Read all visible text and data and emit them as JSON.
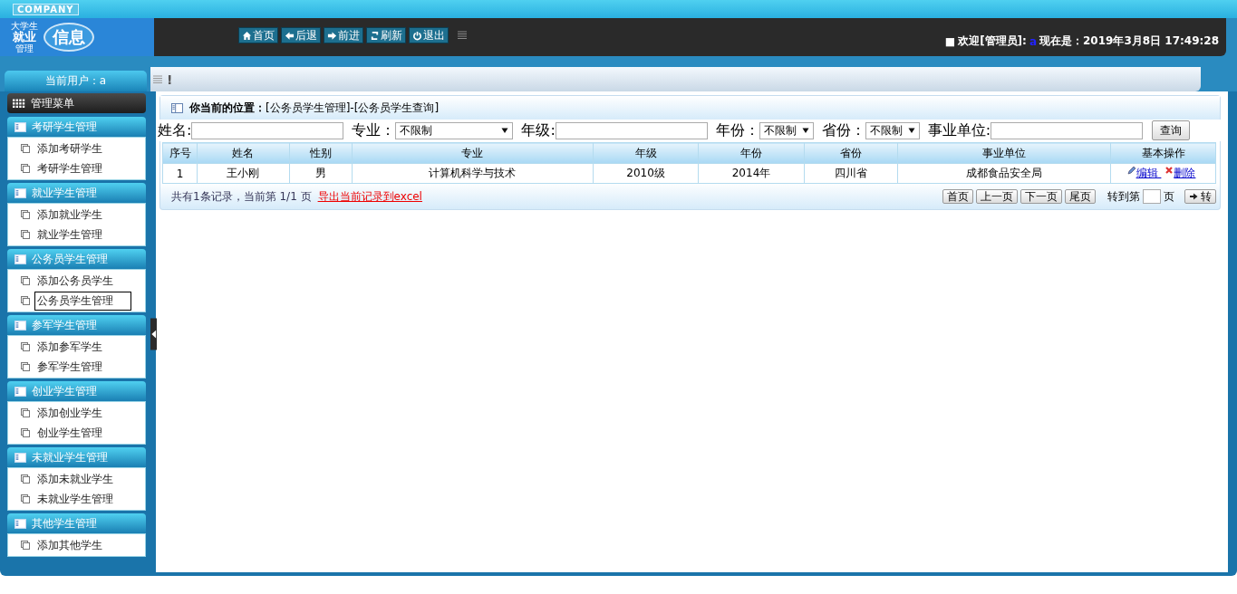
{
  "header": {
    "company": "COMPANY",
    "logo": {
      "small_top": "大学生",
      "main": "就业",
      "small_bottom": "管理",
      "badge": "信息"
    },
    "nav": [
      {
        "kind": "home",
        "label": "首页"
      },
      {
        "kind": "back",
        "label": "后退"
      },
      {
        "kind": "forward",
        "label": "前进"
      },
      {
        "kind": "refresh",
        "label": "刷新"
      },
      {
        "kind": "power",
        "label": "退出"
      }
    ],
    "welcome": {
      "bullet": "■",
      "label": "欢迎[管理员]:",
      "user": "a",
      "datetime": "现在是：2019年3月8日 17:49:28"
    }
  },
  "current_user": "当前用户：a",
  "toolbar_mark": "!",
  "sidebar": {
    "title": "管理菜单",
    "groups": [
      {
        "title": "考研学生管理",
        "items": [
          {
            "label": "添加考研学生",
            "selected": false
          },
          {
            "label": "考研学生管理",
            "selected": false
          }
        ]
      },
      {
        "title": "就业学生管理",
        "items": [
          {
            "label": "添加就业学生",
            "selected": false
          },
          {
            "label": "就业学生管理",
            "selected": false
          }
        ]
      },
      {
        "title": "公务员学生管理",
        "items": [
          {
            "label": "添加公务员学生",
            "selected": false
          },
          {
            "label": "公务员学生管理",
            "selected": true
          }
        ]
      },
      {
        "title": "参军学生管理",
        "items": [
          {
            "label": "添加参军学生",
            "selected": false
          },
          {
            "label": "参军学生管理",
            "selected": false
          }
        ]
      },
      {
        "title": "创业学生管理",
        "items": [
          {
            "label": "添加创业学生",
            "selected": false
          },
          {
            "label": "创业学生管理",
            "selected": false
          }
        ]
      },
      {
        "title": "未就业学生管理",
        "items": [
          {
            "label": "添加未就业学生",
            "selected": false
          },
          {
            "label": "未就业学生管理",
            "selected": false
          }
        ]
      },
      {
        "title": "其他学生管理",
        "items": [
          {
            "label": "添加其他学生",
            "selected": false
          }
        ]
      }
    ]
  },
  "breadcrumb": {
    "label": "你当前的位置：",
    "path": "[公务员学生管理]-[公务员学生查询]"
  },
  "filters": [
    {
      "kind": "input",
      "label": "姓名:"
    },
    {
      "kind": "select",
      "label": "专业：",
      "value": "不限制"
    },
    {
      "kind": "input",
      "label": "年级:"
    },
    {
      "kind": "select",
      "label": "年份：",
      "value": "不限制"
    },
    {
      "kind": "select",
      "label": "省份：",
      "value": "不限制"
    },
    {
      "kind": "input",
      "label": "事业单位:"
    }
  ],
  "search_button": "查询",
  "table": {
    "columns": [
      "序号",
      "姓名",
      "性别",
      "专业",
      "年级",
      "年份",
      "省份",
      "事业单位",
      "基本操作"
    ],
    "rows": [
      {
        "cells": [
          "1",
          "王小刚",
          "男",
          "计算机科学与技术",
          "2010级",
          "2014年",
          "四川省",
          "成都食品安全局"
        ],
        "actions": [
          {
            "kind": "edit",
            "label": "编辑 "
          },
          {
            "kind": "delete",
            "label": "删除"
          }
        ]
      }
    ]
  },
  "pager": {
    "summary": "共有1条记录，当前第 1/1 页",
    "export": "导出当前记录到excel",
    "buttons": [
      "首页",
      "上一页",
      "下一页",
      "尾页"
    ],
    "goto_label": "转到第",
    "page_unit": "页",
    "go_button": "转"
  }
}
